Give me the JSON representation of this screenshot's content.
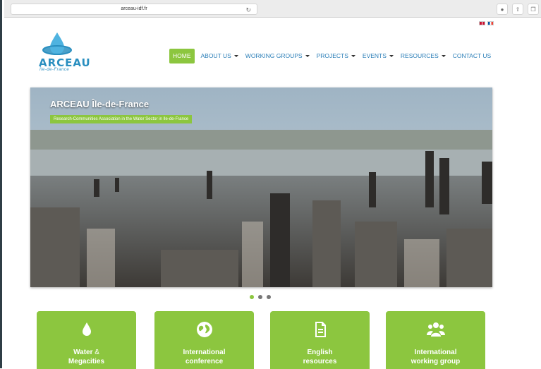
{
  "browser": {
    "url": "arceau-idf.fr",
    "reload_icon": "reload-icon",
    "tool_icons": [
      "download-icon",
      "share-icon",
      "tabs-icon"
    ]
  },
  "header": {
    "logo_text": "ARCEAU",
    "logo_sub": "Île-de-France",
    "languages": [
      "uk-flag-icon",
      "fr-flag-icon"
    ]
  },
  "nav": {
    "items": [
      {
        "label": "HOME",
        "active": true,
        "dropdown": false
      },
      {
        "label": "ABOUT US",
        "dropdown": true
      },
      {
        "label": "WORKING GROUPS",
        "dropdown": true
      },
      {
        "label": "PROJECTS",
        "dropdown": true
      },
      {
        "label": "EVENTS",
        "dropdown": true
      },
      {
        "label": "RESOURCES",
        "dropdown": true
      },
      {
        "label": "CONTACT US",
        "dropdown": false
      }
    ]
  },
  "hero": {
    "title": "ARCEAU Île-de-France",
    "tagline": "Research-Communities Association in the Water Sector in Ile-de-France",
    "slide_count": 3,
    "active_slide": 1
  },
  "cards": [
    {
      "icon": "water-drop-icon",
      "line1": "Water",
      "amp": "&",
      "line2": "Megacities"
    },
    {
      "icon": "globe-icon",
      "line1": "International",
      "line2": "conference"
    },
    {
      "icon": "document-icon",
      "line1": "English",
      "line2": "resources"
    },
    {
      "icon": "group-icon",
      "line1": "International",
      "line2": "working group"
    }
  ],
  "colors": {
    "accent": "#8cc63f",
    "link": "#2c7fb8",
    "logo": "#2a8fc0"
  }
}
